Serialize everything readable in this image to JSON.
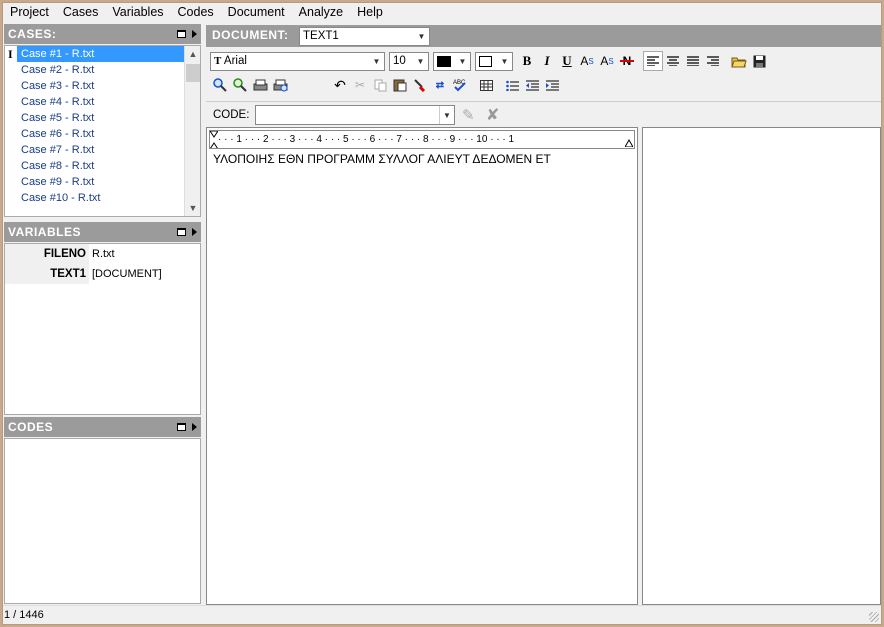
{
  "menu": [
    "Project",
    "Cases",
    "Variables",
    "Codes",
    "Document",
    "Analyze",
    "Help"
  ],
  "cases": {
    "title": "CASES:",
    "items": [
      "Case #1 - R.txt",
      "Case #2 - R.txt",
      "Case #3 - R.txt",
      "Case #4 - R.txt",
      "Case #5 - R.txt",
      "Case #6 - R.txt",
      "Case #7 - R.txt",
      "Case #8 - R.txt",
      "Case #9 - R.txt",
      "Case #10 - R.txt"
    ],
    "selected_index": 0
  },
  "variables": {
    "title": "VARIABLES",
    "rows": [
      {
        "name": "FILENO",
        "value": "R.txt"
      },
      {
        "name": "TEXT1",
        "value": "[DOCUMENT]"
      }
    ]
  },
  "codes": {
    "title": "CODES"
  },
  "document": {
    "label": "DOCUMENT:",
    "selected": "TEXT1",
    "font": "Arial",
    "font_size": "10",
    "code_label": "CODE:",
    "code_value": "",
    "ruler": "· · · 1 · · · 2 · · · 3 · · · 4 · · · 5 · · · 6 · · · 7 · · · 8 · · · 9 · · · 10 · · · 1",
    "text": "ΥΛΟΠΟΙΗΣ ΕΘΝ ΠΡΟΓΡΑΜΜ ΣΥΛΛΟΓ ΑΛΙΕΥΤ ΔΕΔΟΜΕΝ ΕΤ"
  },
  "toolbar": {
    "bold": "B",
    "italic": "I",
    "underline": "U",
    "superscript": "A",
    "superscript_mark": "S",
    "subscript": "A",
    "subscript_mark": "S",
    "strike": "N"
  },
  "status": {
    "position": "1 / 1446"
  },
  "colors": {
    "panel_header": "#9b9b9b",
    "selection": "#3399ff",
    "link_text": "#1a3b8a"
  }
}
